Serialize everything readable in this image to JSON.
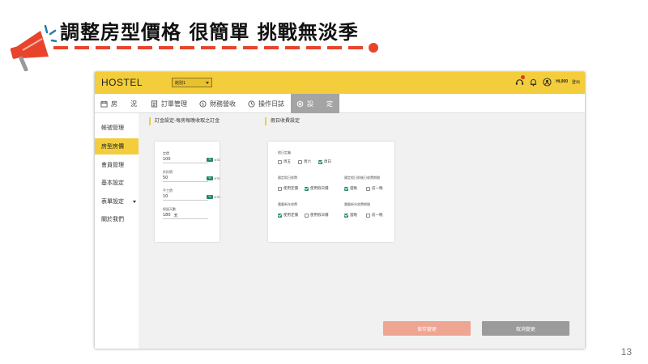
{
  "slide": {
    "title": "調整房型價格 很簡單 挑戰無淡季",
    "page_number": "13",
    "accent_color": "#e8442c"
  },
  "app": {
    "brand": "HOSTEL",
    "store_select": "館別1",
    "user": {
      "name": "Hi,000",
      "logout": "登出"
    },
    "colors": {
      "primary": "#f3cd3b",
      "check": "#1e8a63",
      "save": "#eea592",
      "cancel": "#9b9b9b"
    },
    "tabs": [
      {
        "label": "房　　況",
        "icon": "calendar-icon"
      },
      {
        "label": "訂單管理",
        "icon": "document-icon"
      },
      {
        "label": "財務營收",
        "icon": "dollar-icon"
      },
      {
        "label": "操作日誌",
        "icon": "history-icon"
      },
      {
        "label": "設　　定",
        "icon": "settings-icon",
        "active": true
      }
    ],
    "sidebar": [
      {
        "label": "帳號管理"
      },
      {
        "label": "房型房價",
        "active": true
      },
      {
        "label": "會員管理"
      },
      {
        "label": "基本設定"
      },
      {
        "label": "表單設定",
        "has_caret": true
      },
      {
        "label": "關於我們"
      }
    ],
    "deposit_section": {
      "title": "訂金設定-每房每晚收取之訂金",
      "fields": [
        {
          "label": "定價",
          "value": "100",
          "unit_badge": "%",
          "unit": "NTD"
        },
        {
          "label": "折扣價",
          "value": "50",
          "unit_badge": "%",
          "unit": "NTD"
        },
        {
          "label": "手工價",
          "value": "10",
          "unit_badge": "%",
          "unit": "NTD"
        },
        {
          "label": "保留天數",
          "value": "180",
          "unit": "天"
        }
      ]
    },
    "holiday_section": {
      "title": "假日收費設定",
      "holiday_days": {
        "label": "假日定義",
        "options": [
          {
            "label": "周五",
            "checked": false
          },
          {
            "label": "周六",
            "checked": false
          },
          {
            "label": "周日",
            "checked": true
          }
        ]
      },
      "fixed_holiday": {
        "label": "國定假日收費",
        "options": [
          {
            "label": "使用定價",
            "checked": false
          },
          {
            "label": "使用假日價",
            "checked": true
          }
        ]
      },
      "fixed_holiday_period": {
        "label": "國定假日前後日收費期間",
        "options": [
          {
            "label": "當晚",
            "checked": true
          },
          {
            "label": "前一晚",
            "checked": false
          }
        ]
      },
      "new_year": {
        "label": "農曆新年收費",
        "options": [
          {
            "label": "使用定價",
            "checked": true
          },
          {
            "label": "使用假日價",
            "checked": false
          }
        ]
      },
      "new_year_period": {
        "label": "農曆新年收費期間",
        "options": [
          {
            "label": "當晚",
            "checked": true
          },
          {
            "label": "前一晚",
            "checked": false
          }
        ]
      }
    },
    "buttons": {
      "save": "保存變更",
      "cancel": "取消變更"
    }
  }
}
